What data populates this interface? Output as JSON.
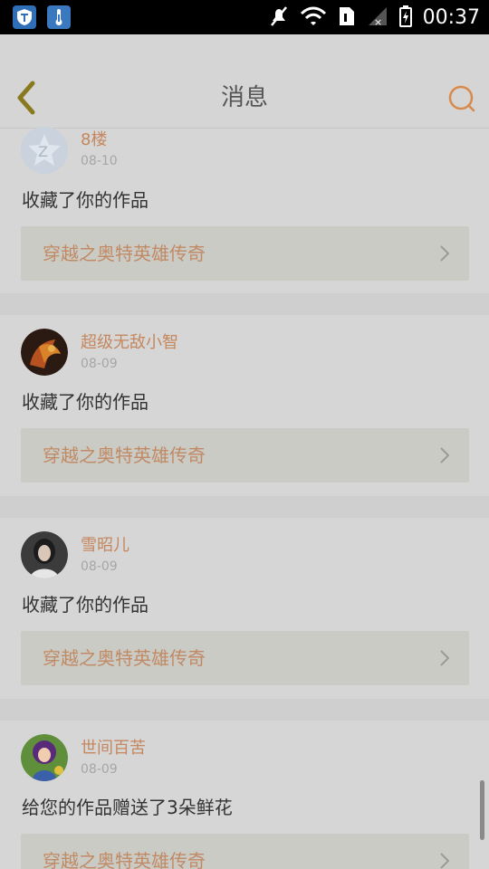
{
  "status_bar": {
    "time": "00:37",
    "icons": [
      "shield-icon",
      "thermometer-icon",
      "mute-icon",
      "wifi-icon",
      "sim-icon",
      "signal-icon",
      "battery-icon"
    ]
  },
  "header": {
    "title": "消息",
    "back_icon": "chevron-left-icon",
    "search_icon": "search-icon"
  },
  "messages": [
    {
      "username": "8楼",
      "date": "08-10",
      "action": "收藏了你的作品",
      "work_title": "穿越之奥特英雄传奇"
    },
    {
      "username": "超级无敌小智",
      "date": "08-09",
      "action": "收藏了你的作品",
      "work_title": "穿越之奥特英雄传奇"
    },
    {
      "username": "雪昭儿",
      "date": "08-09",
      "action": "收藏了你的作品",
      "work_title": "穿越之奥特英雄传奇"
    },
    {
      "username": "世间百苦",
      "date": "08-09",
      "action": "给您的作品赠送了3朵鲜花",
      "work_title": "穿越之奥特英雄传奇"
    }
  ],
  "colors": {
    "accent": "#c4875e",
    "back_arrow": "#8a7a1f",
    "search_icon": "#d98a4a"
  }
}
